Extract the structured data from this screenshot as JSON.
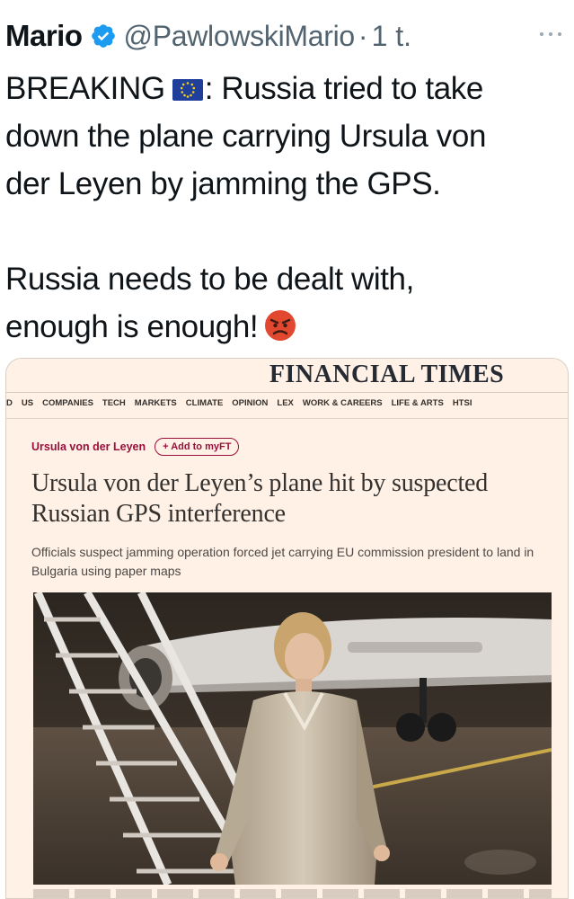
{
  "tweet": {
    "name": "Mario",
    "handle": "@PawlowskiMario",
    "separator": "·",
    "time": "1 t.",
    "more_icon": "more-dots-icon",
    "text_lines": [
      "BREAKING",
      ": Russia tried to take",
      "down the plane carrying Ursula von",
      "der Leyen by jamming the GPS.",
      "Russia needs to be dealt with,",
      "enough is enough!"
    ],
    "emoji": [
      "eu-flag-icon",
      "angry-face-icon"
    ]
  },
  "article": {
    "masthead": "FINANCIAL TIMES",
    "nav": [
      "US",
      "COMPANIES",
      "TECH",
      "MARKETS",
      "CLIMATE",
      "OPINION",
      "LEX",
      "WORK & CAREERS",
      "LIFE & ARTS",
      "HTSI"
    ],
    "nav_fragment": "D",
    "topic": "Ursula von der Leyen",
    "myft_label": "+ Add to myFT",
    "headline": "Ursula von der Leyen’s plane hit by suspected Russian GPS interference",
    "standfirst": "Officials suspect jamming operation forced jet carrying EU commission president to land in Bulgaria using paper maps",
    "photo": "ursula-von-der-leyen-aircraft-stairs-photo",
    "colors": {
      "ft_background": "#fff1e5",
      "ft_claret": "#990f3d",
      "verified_blue": "#1d9bf0"
    }
  }
}
